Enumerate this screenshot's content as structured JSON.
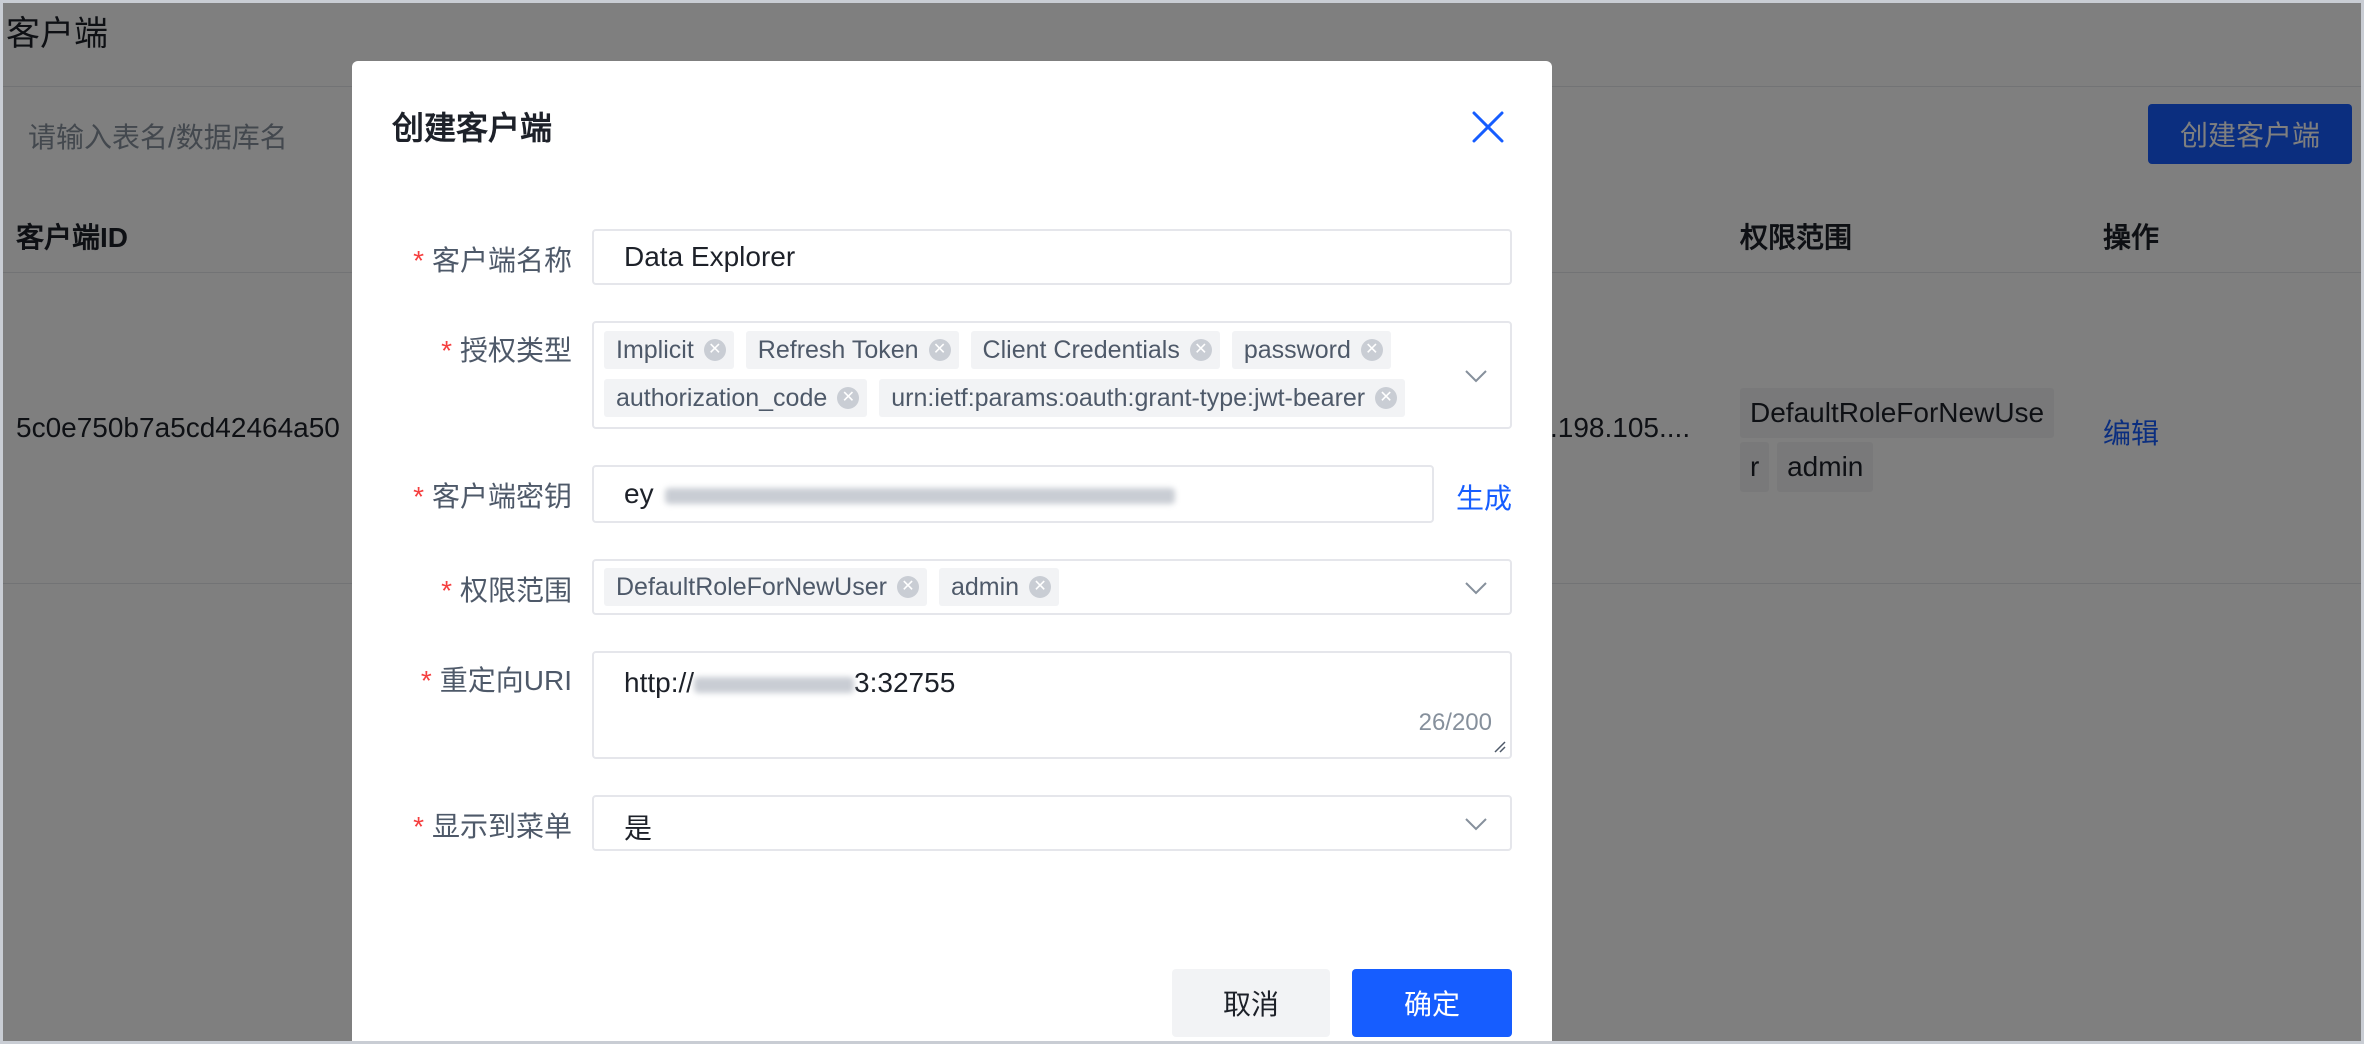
{
  "page": {
    "title": "客户端",
    "search_placeholder": "请输入表名/数据库名",
    "create_button": "创建客户端"
  },
  "table": {
    "headers": {
      "client_id": "客户端ID",
      "scope": "权限范围",
      "actions": "操作"
    },
    "row": {
      "client_id": "5c0e750b7a5cd42464a50",
      "address": ".198.105....",
      "scope_tag_1": "DefaultRoleForNewUse",
      "scope_tag_1_wrap": "r",
      "scope_tag_2": "admin",
      "action": "编辑"
    }
  },
  "dialog": {
    "title": "创建客户端",
    "fields": {
      "name": {
        "label": "客户端名称",
        "value": "Data Explorer"
      },
      "grant_types": {
        "label": "授权类型",
        "tags": [
          "Implicit",
          "Refresh Token",
          "Client Credentials",
          "password",
          "authorization_code",
          "urn:ietf:params:oauth:grant-type:jwt-bearer"
        ]
      },
      "secret": {
        "label": "客户端密钥",
        "value_prefix": "ey",
        "generate": "生成"
      },
      "scope": {
        "label": "权限范围",
        "tags": [
          "DefaultRoleForNewUser",
          "admin"
        ]
      },
      "redirect_uri": {
        "label": "重定向URI",
        "value_prefix": "http://",
        "value_suffix": "3:32755",
        "counter": "26/200"
      },
      "show_in_menu": {
        "label": "显示到菜单",
        "value": "是"
      }
    },
    "buttons": {
      "cancel": "取消",
      "ok": "确定"
    }
  },
  "colors": {
    "primary": "#165dff",
    "required": "#f53f3f",
    "tag_bg": "#f2f3f5",
    "mask": "rgba(0,0,0,0.5)"
  }
}
